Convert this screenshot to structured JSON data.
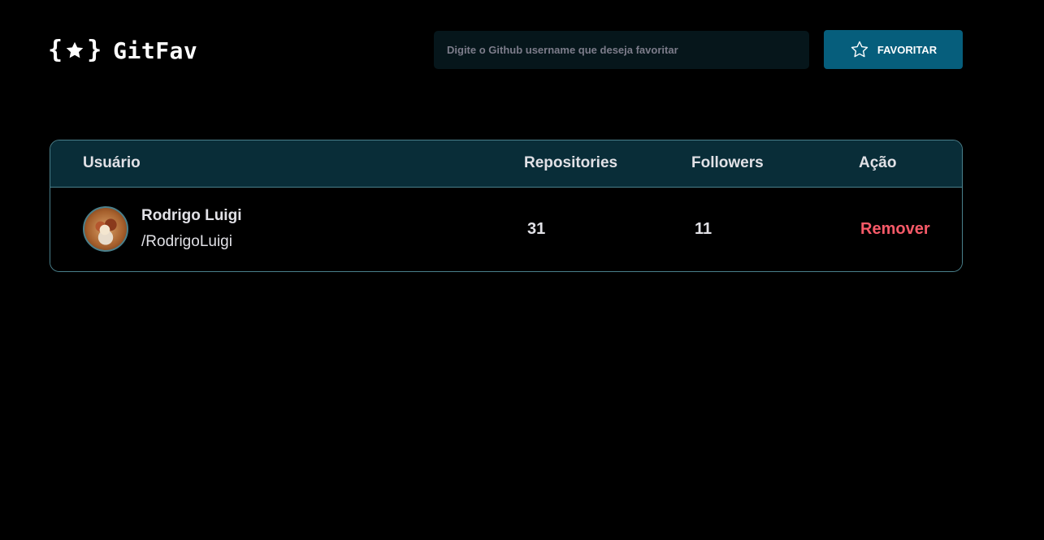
{
  "header": {
    "logo_open_brace": "{",
    "logo_close_brace": "}",
    "logo_text": "GitFav",
    "search_placeholder": "Digite o Github username que deseja favoritar",
    "search_value": "",
    "favorite_button_label": "FAVORITAR"
  },
  "table": {
    "columns": [
      "Usuário",
      "Repositories",
      "Followers",
      "Ação"
    ],
    "rows": [
      {
        "name": "Rodrigo Luigi",
        "login": "/RodrigoLuigi",
        "repositories": "31",
        "followers": "11",
        "action_label": "Remover"
      }
    ]
  },
  "colors": {
    "background": "#000000",
    "header_row": "#092D38",
    "border": "#4A808C",
    "button": "#065E7C",
    "input": "#06161B",
    "remove": "#F75A68"
  },
  "icons": {
    "logo": "star-in-braces-icon",
    "favorite_button": "star-outline-icon"
  }
}
